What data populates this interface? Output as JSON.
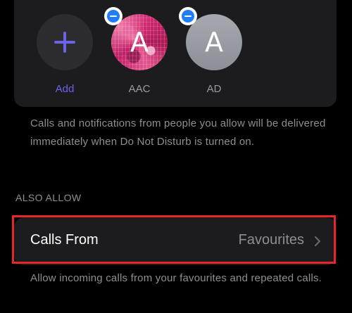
{
  "people": {
    "items": [
      {
        "label": "Add",
        "initial": "",
        "type": "add"
      },
      {
        "label": "AAC",
        "initial": "A",
        "type": "contact"
      },
      {
        "label": "AD",
        "initial": "A",
        "type": "contact"
      }
    ],
    "description": "Calls and notifications from people you allow will be delivered immediately when Do Not Disturb is turned on."
  },
  "also_allow": {
    "header": "ALSO ALLOW",
    "calls_from": {
      "label": "Calls From",
      "value": "Favourites",
      "chevron": "chevron-right-icon"
    },
    "description": "Allow incoming calls from your favourites and repeated calls."
  },
  "colors": {
    "background": "#000000",
    "card": "#1c1c1e",
    "accent": "#6a63e8",
    "remove_badge": "#1f7ef6",
    "highlight": "#e5262a",
    "secondary_text": "#8e8e93"
  }
}
